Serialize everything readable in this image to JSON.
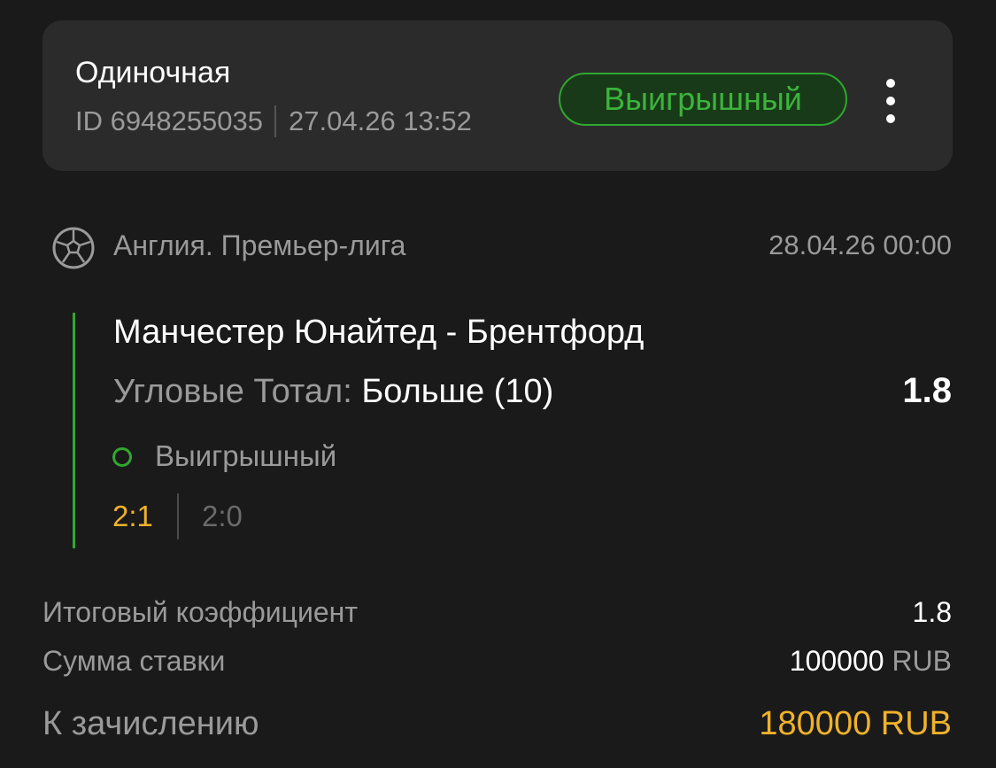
{
  "header": {
    "bet_type": "Одиночная",
    "id_label": "ID 6948255035",
    "placed_at": "27.04.26 13:52",
    "status": "Выигрышный",
    "status_color": "#2fa82f"
  },
  "event": {
    "sport_icon": "soccer-ball-icon",
    "league": "Англия. Премьер-лига",
    "datetime": "28.04.26 00:00",
    "match": "Манчестер Юнайтед - Брентфорд",
    "market_label": "Угловые Тотал:",
    "market_pick": "Больше (10)",
    "odds": "1.8",
    "result": "Выигрышный",
    "score_final": "2:1",
    "score_half": "2:0"
  },
  "summary": {
    "total_odds_label": "Итоговый коэффициент",
    "total_odds_value": "1.8",
    "stake_label": "Сумма ставки",
    "stake_amount": "100000",
    "stake_currency": "RUB",
    "payout_label": "К зачислению",
    "payout_value": "180000 RUB"
  },
  "colors": {
    "background": "#1a1a1a",
    "card": "#2b2b2b",
    "win_green": "#2fa82f",
    "payout_gold": "#f0b22a",
    "muted_text": "#9a9a9a"
  }
}
